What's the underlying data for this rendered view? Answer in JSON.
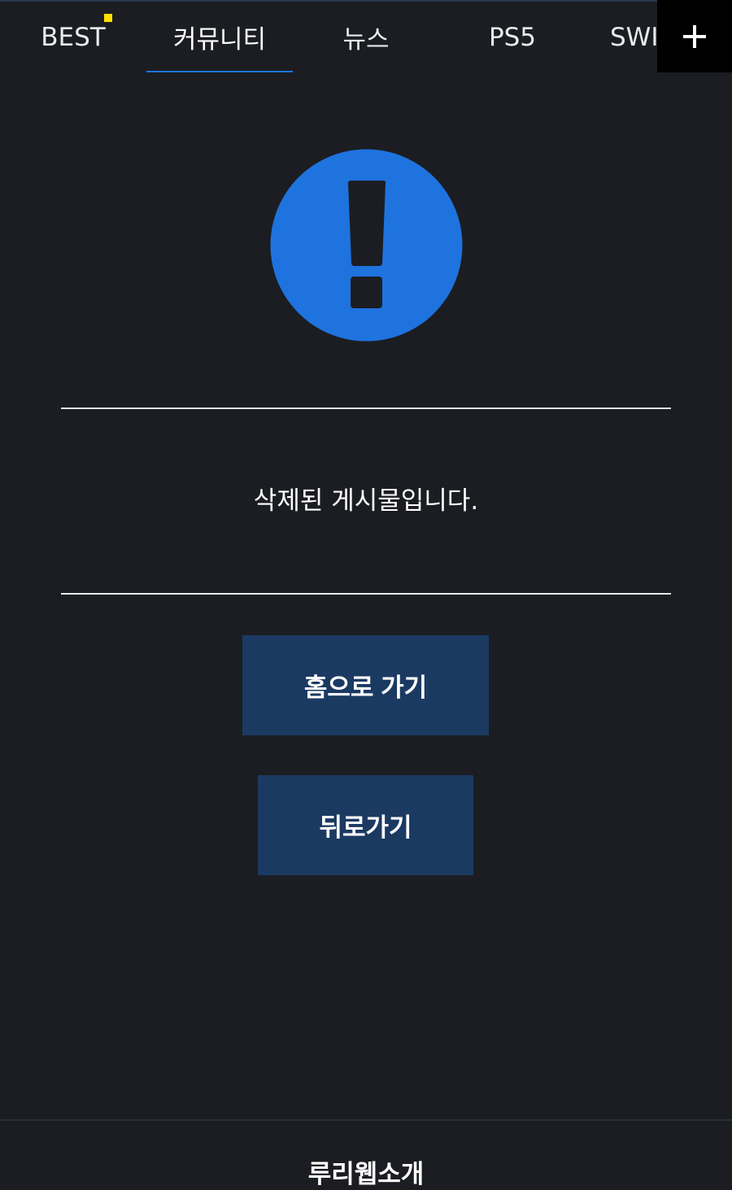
{
  "tabs": [
    {
      "label": "BEST"
    },
    {
      "label": "커뮤니티"
    },
    {
      "label": "뉴스"
    },
    {
      "label": "PS5"
    },
    {
      "label": "SWI"
    }
  ],
  "active_tab": "커뮤니티",
  "add_tab_icon": "plus-icon",
  "alert_icon": "exclamation-circle-icon",
  "message": "삭제된 게시물입니다.",
  "buttons": {
    "home": "홈으로 가기",
    "back": "뒤로가기"
  },
  "footer": {
    "brand": "루리웹소개"
  },
  "colors": {
    "background": "#1b1d22",
    "accent": "#1e73de",
    "button": "#1b3a62",
    "new_badge": "#ffe000"
  }
}
